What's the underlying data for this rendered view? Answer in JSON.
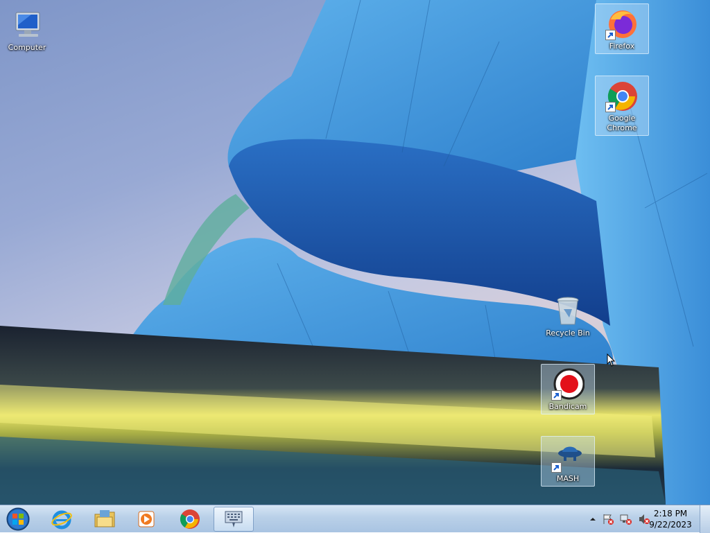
{
  "desktop": {
    "icons": [
      {
        "label": "Computer",
        "icon": "computer-icon"
      },
      {
        "label": "Firefox",
        "icon": "firefox-icon"
      },
      {
        "label": "Google Chrome",
        "icon": "chrome-icon"
      },
      {
        "label": "Recycle Bin",
        "icon": "recycle-bin-icon"
      },
      {
        "label": "Bandicam",
        "icon": "bandicam-icon"
      },
      {
        "label": "MASH",
        "icon": "mash-icon"
      }
    ]
  },
  "taskbar": {
    "pinned": [
      "start-orb-icon",
      "internet-explorer-icon",
      "file-explorer-icon",
      "media-player-icon",
      "chrome-icon",
      "on-screen-keyboard-icon"
    ],
    "tray_icons": [
      "show-hidden-icons-icon",
      "action-center-error-icon",
      "network-error-icon",
      "volume-muted-icon"
    ],
    "clock": {
      "time": "2:18 PM",
      "date": "9/22/2023"
    }
  },
  "colors": {
    "taskbar": "#b9d0e8",
    "building_blue": "#3f8fd6",
    "yellow_streak": "#e8e46a"
  }
}
